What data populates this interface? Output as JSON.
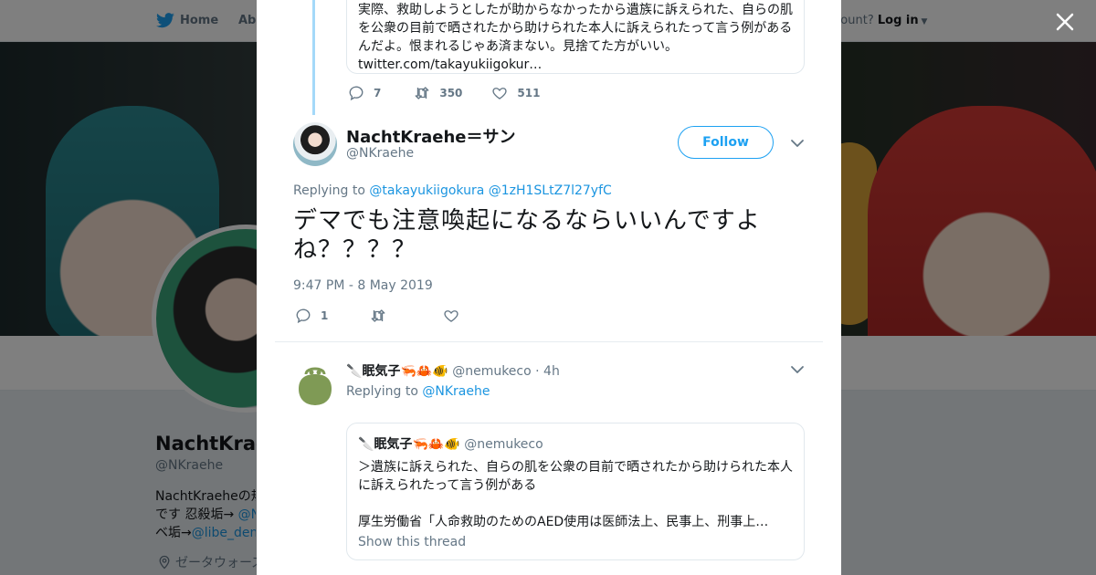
{
  "background_page": {
    "nav": {
      "home_label": "Home",
      "about_label": "Abo",
      "account_prompt": "ccount?",
      "login_label": "Log in"
    },
    "profile": {
      "name": "NachtKraeh",
      "handle": "@NKraehe",
      "bio_line1_pre": "NachtKraeheの規",
      "bio_line2_pre": "です 忍殺垢→ ",
      "bio_line2_link": "@N",
      "bio_line3_pre": "ベ垢→",
      "bio_line3_link": "@libe_dem",
      "location": "ゼータウォーズ"
    }
  },
  "modal": {
    "close_icon": "close-icon",
    "quoted_top": {
      "text_lines": [
        "実際、救助しようとしたが助からなかったから遺族に訴えられた、自らの肌",
        "を公衆の目前で晒されたから助けられた本人に訴えられたって言う例がある",
        "んだよ。恨まれるじゃあ済まない。見捨てた方がいい。",
        "twitter.com/takayukiigokur…"
      ]
    },
    "prev_actions": {
      "replies": "7",
      "retweets": "350",
      "likes": "511"
    },
    "main_tweet": {
      "name": "NachtKraehe＝サン",
      "handle": "@NKraehe",
      "follow_label": "Follow",
      "replying_to_label": "Replying to",
      "replying_to_users": [
        "@takayukiigokura",
        "@1zH1SLtZ7l27yfC"
      ],
      "text": "デマでも注意喚起になるならいいんですよね？？？？",
      "timestamp": "9:47 PM - 8 May 2019",
      "actions": {
        "replies": "1",
        "retweets": "",
        "likes": ""
      }
    },
    "reply_tweet": {
      "name": "眠気子",
      "name_emojis": [
        "🔪",
        "🦐",
        "🦀",
        "🐠"
      ],
      "handle": "@nemukeco",
      "time": "· 4h",
      "replying_to_label": "Replying to",
      "replying_to_user": "@NKraehe",
      "quoted": {
        "name": "眠気子",
        "handle": "@nemukeco",
        "text": "＞遺族に訴えられた、自らの肌を公衆の目前で晒されたから助けられた本人に訴えられたって言う例がある",
        "text2": "厚生労働省「人命救助のためのAED使用は医師法上、民事上、刑事上…",
        "show_thread_label": "Show this thread"
      }
    }
  },
  "colors": {
    "accent": "#1da1f2",
    "link": "#1b95e0",
    "muted": "#657786",
    "thread_line": "#a4d9f9",
    "avatar_green": "#7f9a55"
  }
}
